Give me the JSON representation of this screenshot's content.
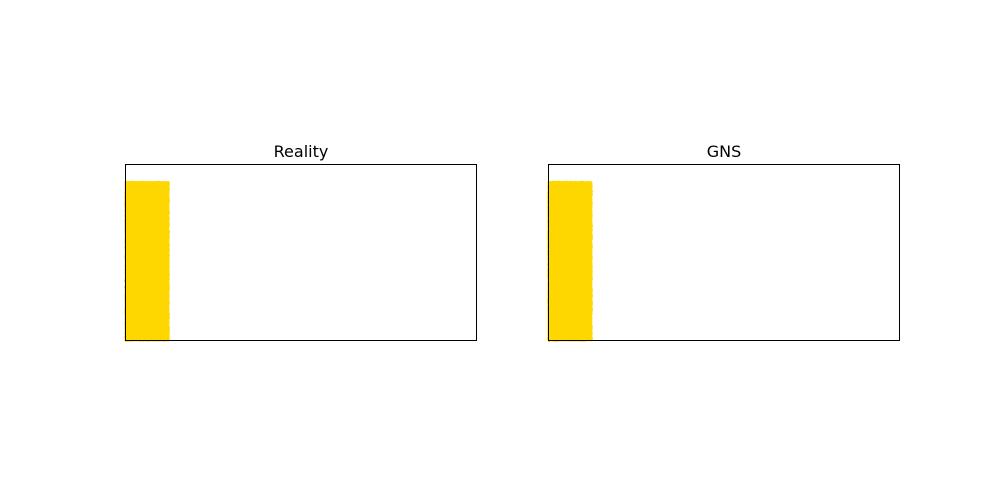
{
  "chart_data": [
    {
      "type": "scatter",
      "title": "Reality",
      "xlim": [
        0,
        1
      ],
      "ylim": [
        0,
        0.5
      ],
      "grid": false,
      "ticks_visible": false,
      "series": [
        {
          "color": "#FFD700",
          "x_range": [
            0.0,
            0.12
          ],
          "y_range": [
            0.0,
            0.45
          ]
        }
      ]
    },
    {
      "type": "scatter",
      "title": "GNS",
      "xlim": [
        0,
        1
      ],
      "ylim": [
        0,
        0.5
      ],
      "grid": false,
      "ticks_visible": false,
      "series": [
        {
          "color": "#FFD700",
          "x_range": [
            0.0,
            0.12
          ],
          "y_range": [
            0.0,
            0.45
          ]
        }
      ]
    }
  ]
}
